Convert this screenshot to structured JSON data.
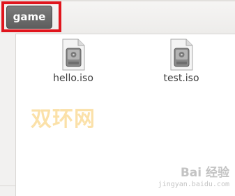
{
  "pathbar": {
    "current_folder": "game"
  },
  "files": [
    {
      "name": "hello.iso",
      "icon": "disc-image-icon"
    },
    {
      "name": "test.iso",
      "icon": "disc-image-icon"
    }
  ],
  "watermarks": {
    "site_text": "双环网",
    "baidu_text": "Bai 经验",
    "baidu_url": "jingyan.baidu.com"
  },
  "colors": {
    "highlight": "#e0151d",
    "path_button_bg": "#6b6b6b",
    "watermark_orange": "#f8c964"
  }
}
